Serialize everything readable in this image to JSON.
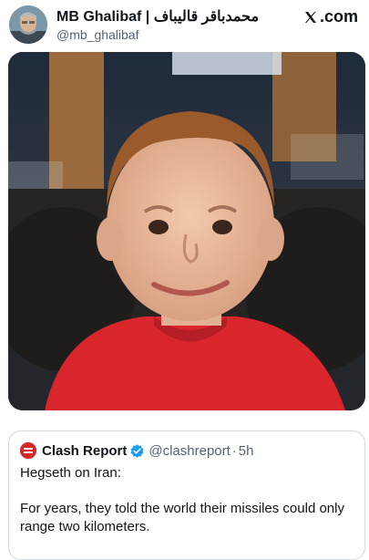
{
  "author": {
    "display_name": "MB Ghalibaf | محمدباقر قالیباف",
    "handle": "@mb_ghalibaf"
  },
  "brand": {
    "label": ".com",
    "icon": "x-logo-icon"
  },
  "media": {
    "description": "photo-of-child"
  },
  "quoted_post": {
    "author_name": "Clash Report",
    "verified": true,
    "handle": "@clashreport",
    "separator": "·",
    "time": "5h",
    "line1": "Hegseth on Iran:",
    "line2": "For years, they told the world their missiles could only range two kilometers."
  },
  "colors": {
    "text_primary": "#0f1419",
    "text_secondary": "#536471",
    "verified_blue": "#1d9bf0",
    "clash_red": "#d62828",
    "border": "#cfd9de"
  }
}
